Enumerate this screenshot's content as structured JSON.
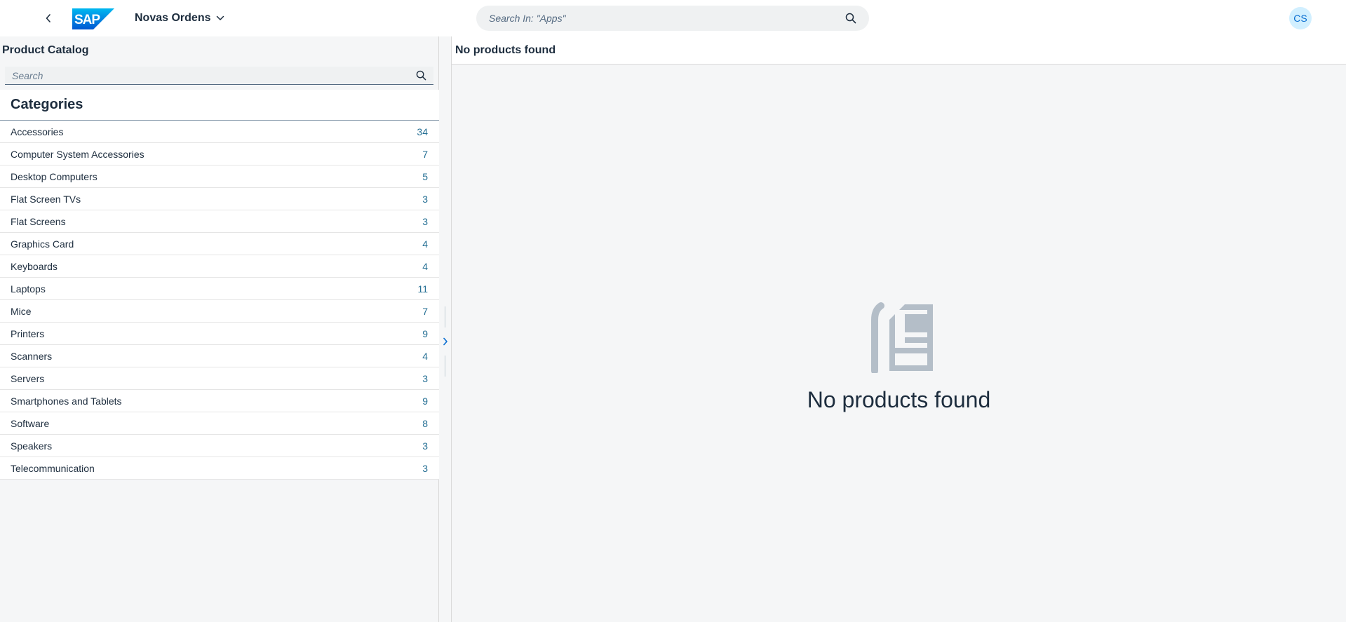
{
  "shell": {
    "app_title": "Novas Ordens",
    "search_placeholder": "Search In: \"Apps\"",
    "avatar_initials": "CS",
    "brand_color": "#0a6ed1"
  },
  "master": {
    "title": "Product Catalog",
    "search_placeholder": "Search",
    "categories_heading": "Categories",
    "categories": [
      {
        "name": "Accessories",
        "count": "34"
      },
      {
        "name": "Computer System Accessories",
        "count": "7"
      },
      {
        "name": "Desktop Computers",
        "count": "5"
      },
      {
        "name": "Flat Screen TVs",
        "count": "3"
      },
      {
        "name": "Flat Screens",
        "count": "3"
      },
      {
        "name": "Graphics Card",
        "count": "4"
      },
      {
        "name": "Keyboards",
        "count": "4"
      },
      {
        "name": "Laptops",
        "count": "11"
      },
      {
        "name": "Mice",
        "count": "7"
      },
      {
        "name": "Printers",
        "count": "9"
      },
      {
        "name": "Scanners",
        "count": "4"
      },
      {
        "name": "Servers",
        "count": "3"
      },
      {
        "name": "Smartphones and Tablets",
        "count": "9"
      },
      {
        "name": "Software",
        "count": "8"
      },
      {
        "name": "Speakers",
        "count": "3"
      },
      {
        "name": "Telecommunication",
        "count": "3"
      }
    ]
  },
  "detail": {
    "header_title": "No products found",
    "empty_message": "No products found",
    "illustration_icon": "document-icon"
  }
}
